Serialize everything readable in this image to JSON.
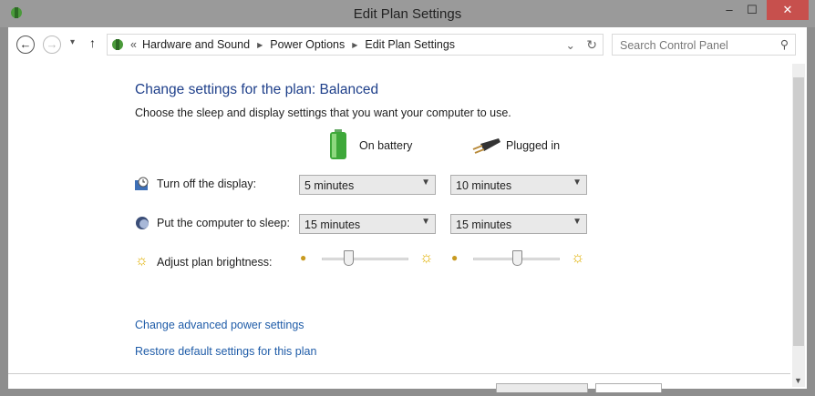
{
  "window": {
    "title": "Edit Plan Settings",
    "minimize": "–",
    "maximize": "☐",
    "close": "✕"
  },
  "nav": {
    "back": "←",
    "forward": "→",
    "recent": "▾",
    "up": "↑",
    "separator": "«",
    "breadcrumb": [
      "Hardware and Sound",
      "Power Options",
      "Edit Plan Settings"
    ],
    "refresh": "↻",
    "dropdown": "⌄",
    "search_placeholder": "Search Control Panel",
    "search_icon": "⚲"
  },
  "main": {
    "title": "Change settings for the plan: Balanced",
    "subtitle": "Choose the sleep and display settings that you want your computer to use.",
    "col_battery": "On battery",
    "col_plugged": "Plugged in",
    "rows": [
      {
        "label": "Turn off the display:",
        "battery": "5 minutes",
        "plugged": "10 minutes"
      },
      {
        "label": "Put the computer to sleep:",
        "battery": "15 minutes",
        "plugged": "15 minutes"
      }
    ],
    "brightness_label": "Adjust plan brightness:",
    "brightness_battery_percent": 30,
    "brightness_plugged_percent": 50,
    "link_advanced": "Change advanced power settings",
    "link_restore": "Restore default settings for this plan"
  },
  "colors": {
    "accent": "#1e3f8a",
    "link": "#1f5ca8",
    "close": "#c7504d"
  }
}
